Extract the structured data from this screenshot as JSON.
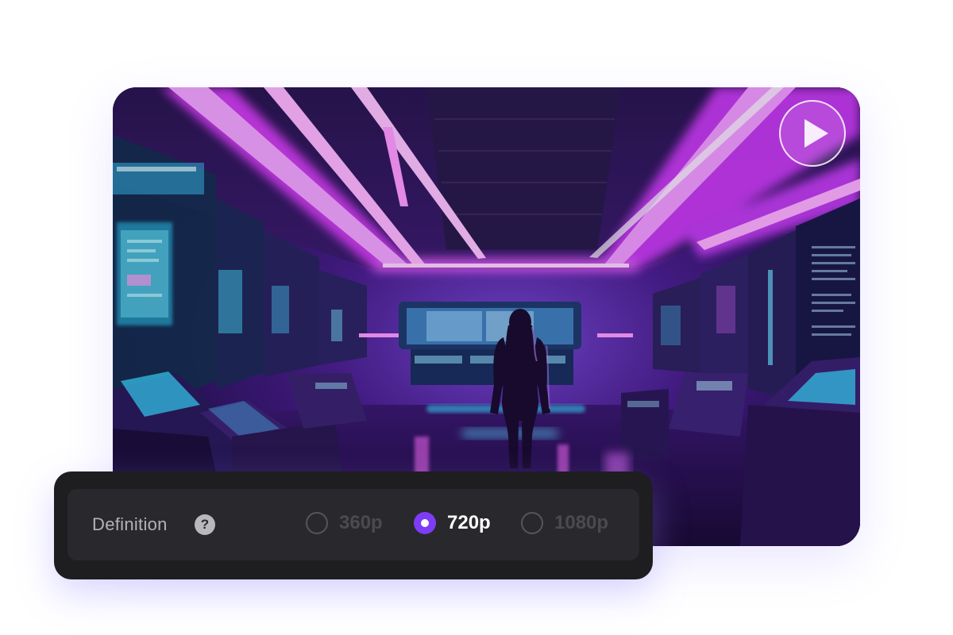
{
  "video": {
    "play_icon": "play-icon",
    "accent_colors": [
      "#e63cff",
      "#b43cff",
      "#3cd8ff",
      "#1a0b35"
    ]
  },
  "definition": {
    "label": "Definition",
    "help_icon": "question-circle-icon",
    "help_glyph": "?",
    "accent_color": "#7d3cf6",
    "options": [
      {
        "label": "360p",
        "selected": false
      },
      {
        "label": "720p",
        "selected": true
      },
      {
        "label": "1080p",
        "selected": false
      }
    ]
  }
}
